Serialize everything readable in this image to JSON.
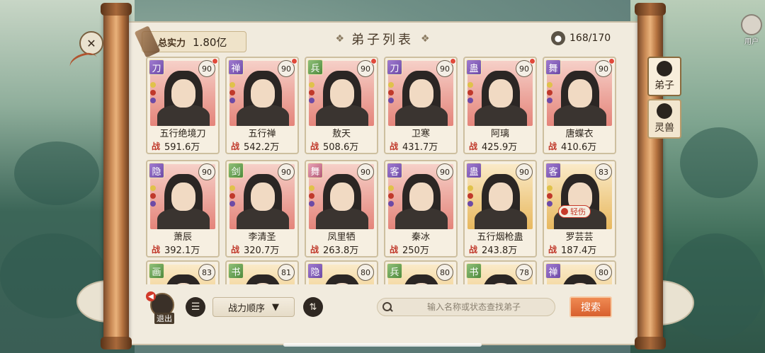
{
  "header": {
    "power_label": "总实力",
    "power_value": "1.80亿",
    "title": "弟子列表",
    "capacity": "168/170"
  },
  "side_tabs": [
    {
      "label": "弟子",
      "active": true
    },
    {
      "label": "灵兽",
      "active": false
    }
  ],
  "disciples": [
    {
      "name": "五行绝境刀",
      "level": "90",
      "power": "591.6万",
      "badge": "刀",
      "badge_color": "purple",
      "bg": "red",
      "dot": true
    },
    {
      "name": "五行禅",
      "level": "90",
      "power": "542.2万",
      "badge": "禅",
      "badge_color": "purple",
      "bg": "red",
      "dot": true
    },
    {
      "name": "敖天",
      "level": "90",
      "power": "508.6万",
      "badge": "兵",
      "badge_color": "green",
      "bg": "red",
      "dot": true
    },
    {
      "name": "卫寒",
      "level": "90",
      "power": "431.7万",
      "badge": "刀",
      "badge_color": "purple",
      "bg": "red",
      "dot": true
    },
    {
      "name": "阿璃",
      "level": "90",
      "power": "425.9万",
      "badge": "蛊",
      "badge_color": "purple",
      "bg": "red",
      "dot": true
    },
    {
      "name": "唐蝶衣",
      "level": "90",
      "power": "410.6万",
      "badge": "舞",
      "badge_color": "purple",
      "bg": "red",
      "dot": true
    },
    {
      "name": "萧辰",
      "level": "90",
      "power": "392.1万",
      "badge": "隐",
      "badge_color": "purple",
      "bg": "red",
      "dot": false
    },
    {
      "name": "李清圣",
      "level": "90",
      "power": "320.7万",
      "badge": "剑",
      "badge_color": "green",
      "bg": "red",
      "dot": false
    },
    {
      "name": "凤里牺",
      "level": "90",
      "power": "263.8万",
      "badge": "舞",
      "badge_color": "pink",
      "bg": "red",
      "dot": false
    },
    {
      "name": "秦冰",
      "level": "90",
      "power": "250万",
      "badge": "客",
      "badge_color": "purple",
      "bg": "red",
      "dot": false
    },
    {
      "name": "五行烟枪蛊",
      "level": "90",
      "power": "243.8万",
      "badge": "蛊",
      "badge_color": "purple",
      "bg": "gold",
      "dot": false
    },
    {
      "name": "罗芸芸",
      "level": "83",
      "power": "187.4万",
      "badge": "客",
      "badge_color": "purple",
      "bg": "gold",
      "dot": false,
      "status": "轻伤"
    },
    {
      "name": "",
      "level": "83",
      "power": "",
      "badge": "画",
      "badge_color": "green",
      "bg": "gold",
      "dot": false
    },
    {
      "name": "",
      "level": "81",
      "power": "",
      "badge": "书",
      "badge_color": "green",
      "bg": "gold",
      "dot": false
    },
    {
      "name": "",
      "level": "80",
      "power": "",
      "badge": "隐",
      "badge_color": "purple",
      "bg": "gold",
      "dot": false
    },
    {
      "name": "",
      "level": "80",
      "power": "",
      "badge": "兵",
      "badge_color": "green",
      "bg": "gold",
      "dot": false
    },
    {
      "name": "",
      "level": "78",
      "power": "",
      "badge": "书",
      "badge_color": "green",
      "bg": "gold",
      "dot": false
    },
    {
      "name": "",
      "level": "80",
      "power": "",
      "badge": "禅",
      "badge_color": "purple",
      "bg": "gold",
      "dot": false
    }
  ],
  "power_prefix": "战",
  "footer": {
    "exit_label": "退出",
    "sort_label": "战力顺序",
    "search_placeholder": "输入名称或状态查找弟子",
    "search_button": "搜索"
  },
  "corner": {
    "user_label": "用户"
  }
}
